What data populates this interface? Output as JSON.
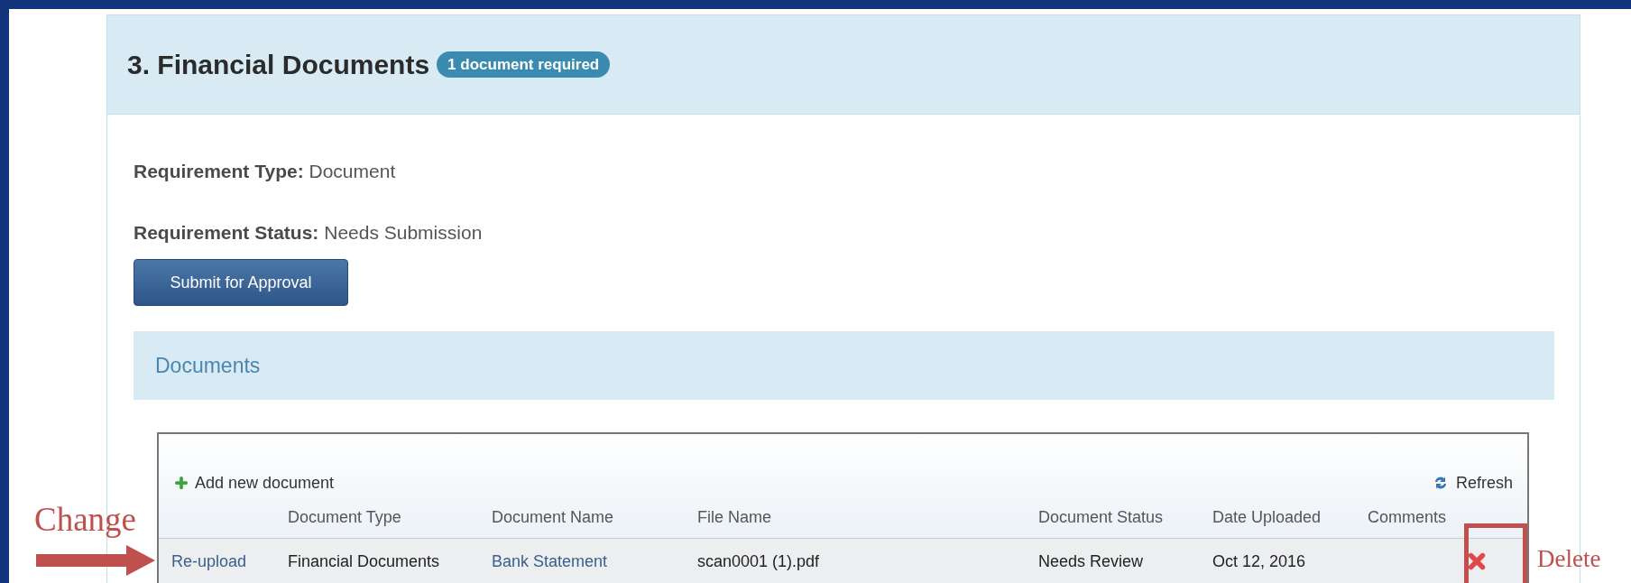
{
  "section": {
    "title": "3. Financial Documents",
    "badge": "1 document required"
  },
  "fields": [
    {
      "label": "Requirement Type:",
      "value": "Document"
    },
    {
      "label": "Requirement Status:",
      "value": "Needs Submission"
    }
  ],
  "submit_button": "Submit for Approval",
  "documents_panel": {
    "title": "Documents"
  },
  "grid": {
    "toolbar": {
      "add": "Add new document",
      "refresh": "Refresh"
    },
    "columns": [
      "Document Type",
      "Document Name",
      "File Name",
      "Document Status",
      "Date Uploaded",
      "Comments"
    ],
    "rows": [
      {
        "action": "Re-upload",
        "cells": [
          "Financial Documents",
          "Bank Statement",
          "scan0001 (1).pdf",
          "Needs Review",
          "Oct 12, 2016",
          ""
        ]
      }
    ]
  },
  "annotations": {
    "change_label": "Change",
    "delete_label": "Delete"
  }
}
